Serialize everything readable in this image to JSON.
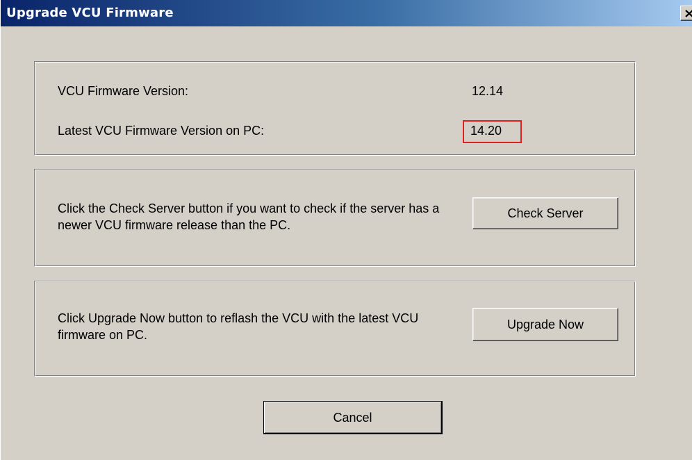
{
  "window": {
    "title": "Upgrade VCU Firmware",
    "close_symbol": "×"
  },
  "versions": {
    "current_label": "VCU Firmware Version:",
    "current_value": "12.14",
    "latest_label": "Latest VCU Firmware Version on PC:",
    "latest_value": "14.20"
  },
  "server_check": {
    "description": "Click the Check Server button if you want to check if the server has a newer VCU firmware release than the PC.",
    "button_label": "Check Server"
  },
  "upgrade": {
    "description": "Click Upgrade Now button to reflash the VCU with the latest VCU firmware on PC.",
    "button_label": "Upgrade Now"
  },
  "footer": {
    "cancel_label": "Cancel"
  },
  "colors": {
    "dialog_background": "#d4d0c8",
    "titlebar_start": "#0a246a",
    "titlebar_end": "#a6caf0",
    "highlight_border": "#e02020"
  },
  "icons": {
    "close": "close-icon"
  }
}
